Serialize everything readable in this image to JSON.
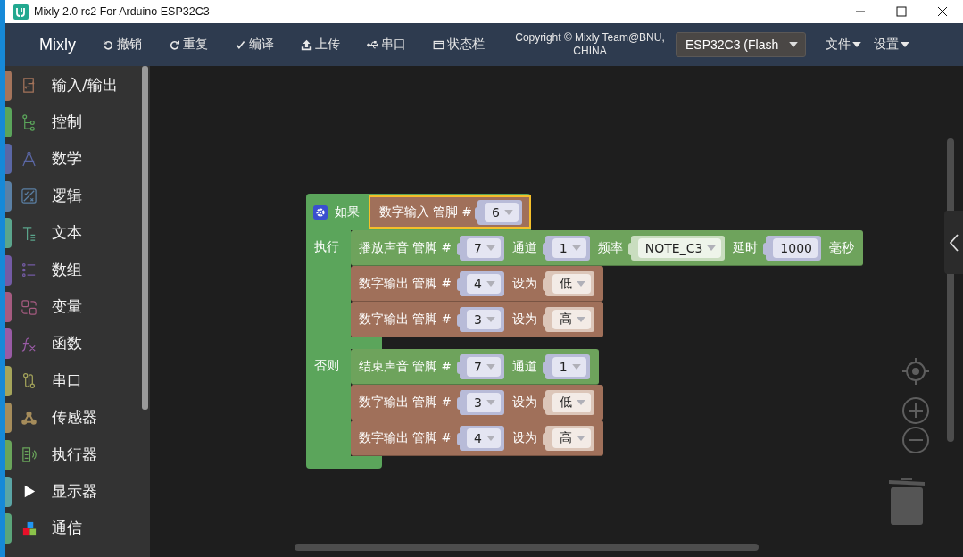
{
  "window": {
    "title": "Mixly 2.0 rc2 For Arduino ESP32C3"
  },
  "navbar": {
    "brand": "Mixly",
    "actions": [
      {
        "label": "撤销"
      },
      {
        "label": "重复"
      },
      {
        "label": "编译"
      },
      {
        "label": "上传"
      },
      {
        "label": "串口"
      },
      {
        "label": "状态栏"
      }
    ],
    "copyright": "Copyright © Mixly Team@BNU, CHINA",
    "board": "ESP32C3 (Flash",
    "menus": [
      {
        "label": "文件"
      },
      {
        "label": "设置"
      }
    ]
  },
  "sidebar": {
    "items": [
      {
        "label": "输入/输出",
        "color": "#a5745b"
      },
      {
        "label": "控制",
        "color": "#5ba55b"
      },
      {
        "label": "数学",
        "color": "#5b67a5"
      },
      {
        "label": "逻辑",
        "color": "#5b80a5"
      },
      {
        "label": "文本",
        "color": "#5ba58c"
      },
      {
        "label": "数组",
        "color": "#745ba5"
      },
      {
        "label": "变量",
        "color": "#a55b80"
      },
      {
        "label": "函数",
        "color": "#995ba5"
      },
      {
        "label": "串口",
        "color": "#a5a55b"
      },
      {
        "label": "传感器",
        "color": "#a58c5b"
      },
      {
        "label": "执行器",
        "color": "#6aa55b"
      },
      {
        "label": "显示器",
        "color": "#5ba5a5"
      },
      {
        "label": "通信",
        "color": "#5ba57a"
      }
    ]
  },
  "workspace": {
    "if_block": {
      "if_label": "如果",
      "condition": {
        "selected": true,
        "parts": [
          {
            "kind": "label",
            "text": "数字输入 管脚 #"
          },
          {
            "kind": "pin",
            "text": "6"
          }
        ]
      },
      "do_label": "执行",
      "do": [
        {
          "kind": "sound",
          "parts": [
            {
              "kind": "label",
              "text": "播放声音 管脚 #"
            },
            {
              "kind": "pin",
              "text": "7"
            },
            {
              "kind": "label",
              "text": "通道"
            },
            {
              "kind": "pin",
              "text": "1"
            },
            {
              "kind": "label",
              "text": "频率"
            },
            {
              "kind": "note",
              "text": "NOTE_C3"
            },
            {
              "kind": "label",
              "text": "延时"
            },
            {
              "kind": "number",
              "text": "1000"
            },
            {
              "kind": "label",
              "text": "毫秒"
            }
          ]
        },
        {
          "kind": "digital",
          "parts": [
            {
              "kind": "label",
              "text": "数字输出 管脚 #"
            },
            {
              "kind": "pin",
              "text": "4"
            },
            {
              "kind": "label",
              "text": "设为"
            },
            {
              "kind": "level",
              "text": "低"
            }
          ]
        },
        {
          "kind": "digital",
          "parts": [
            {
              "kind": "label",
              "text": "数字输出 管脚 #"
            },
            {
              "kind": "pin",
              "text": "3"
            },
            {
              "kind": "label",
              "text": "设为"
            },
            {
              "kind": "level",
              "text": "高"
            }
          ]
        }
      ],
      "else_label": "否则",
      "else": [
        {
          "kind": "sound",
          "parts": [
            {
              "kind": "label",
              "text": "结束声音 管脚 #"
            },
            {
              "kind": "pin",
              "text": "7"
            },
            {
              "kind": "label",
              "text": "通道"
            },
            {
              "kind": "pin",
              "text": "1"
            }
          ]
        },
        {
          "kind": "digital",
          "parts": [
            {
              "kind": "label",
              "text": "数字输出 管脚 #"
            },
            {
              "kind": "pin",
              "text": "3"
            },
            {
              "kind": "label",
              "text": "设为"
            },
            {
              "kind": "level",
              "text": "低"
            }
          ]
        },
        {
          "kind": "digital",
          "parts": [
            {
              "kind": "label",
              "text": "数字输出 管脚 #"
            },
            {
              "kind": "pin",
              "text": "4"
            },
            {
              "kind": "label",
              "text": "设为"
            },
            {
              "kind": "level",
              "text": "高"
            }
          ]
        }
      ]
    }
  }
}
